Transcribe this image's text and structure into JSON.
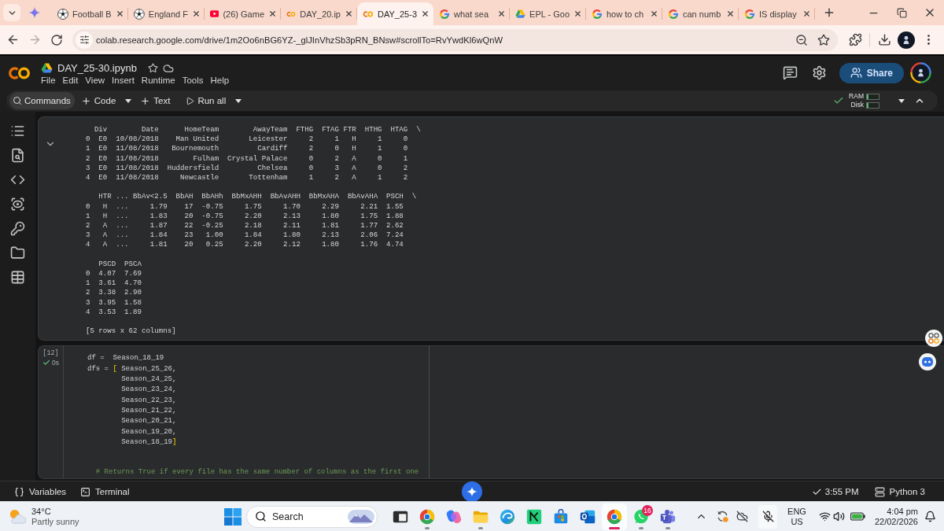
{
  "browser": {
    "tabs": [
      {
        "kind": "football",
        "title": "Football B",
        "selected": false
      },
      {
        "kind": "football",
        "title": "England F",
        "selected": false
      },
      {
        "kind": "youtube",
        "title": "(26) Game",
        "selected": false
      },
      {
        "kind": "colab",
        "title": "DAY_20.ip",
        "selected": false
      },
      {
        "kind": "colab",
        "title": "DAY_25-3",
        "selected": true
      },
      {
        "kind": "google",
        "title": "what sea",
        "selected": false
      },
      {
        "kind": "drive",
        "title": "EPL - Goo",
        "selected": false
      },
      {
        "kind": "google",
        "title": "how to ch",
        "selected": false
      },
      {
        "kind": "google",
        "title": "can numb",
        "selected": false
      },
      {
        "kind": "google",
        "title": "IS display",
        "selected": false
      }
    ],
    "forward_enabled": false,
    "url": "colab.research.google.com/drive/1m2Oo6nBG6YZ-_glJInVhzSb3pRN_BNsw#scrollTo=RvYwdKl6wQnW"
  },
  "notebook": {
    "title": "DAY_25-30.ipynb",
    "menu": [
      "File",
      "Edit",
      "View",
      "Insert",
      "Runtime",
      "Tools",
      "Help"
    ],
    "share": "Share"
  },
  "toolbar": {
    "commands": "Commands",
    "add_code": "Code",
    "add_text": "Text",
    "run_all": "Run all",
    "connected": true,
    "meters": [
      {
        "label": "RAM",
        "level": 0.1
      },
      {
        "label": "Disk",
        "level": 0.1
      }
    ]
  },
  "output": {
    "blocks": [
      {
        "lines": [
          "  Div        Date      HomeTeam        AwayTeam  FTHG  FTAG FTR  HTHG  HTAG  \\",
          "0  E0  10/08/2018    Man United       Leicester     2     1   H     1     0",
          "1  E0  11/08/2018   Bournemouth         Cardiff     2     0   H     1     0",
          "2  E0  11/08/2018        Fulham  Crystal Palace     0     2   A     0     1",
          "3  E0  11/08/2018  Huddersfield         Chelsea     0     3   A     0     2",
          "4  E0  11/08/2018     Newcastle       Tottenham     1     2   A     1     2"
        ]
      },
      {
        "lines": [
          "   HTR ... BbAv<2.5  BbAH  BbAHh  BbMxAHH  BbAvAHH  BbMxAHA  BbAvAHA  PSCH  \\",
          "0   H  ...     1.79    17  -0.75     1.75     1.70     2.29     2.21  1.55",
          "1   H  ...     1.83    20  -0.75     2.20     2.13     1.80     1.75  1.88",
          "2   A  ...     1.87    22  -0.25     2.18     2.11     1.81     1.77  2.62",
          "3   A  ...     1.84    23   1.00     1.84     1.80     2.13     2.06  7.24",
          "4   A  ...     1.81    20   0.25     2.20     2.12     1.80     1.76  4.74"
        ]
      },
      {
        "lines": [
          "   PSCD  PSCA",
          "0  4.07  7.69",
          "1  3.61  4.70",
          "2  3.38  2.90",
          "3  3.95  1.58",
          "4  3.53  1.89"
        ]
      },
      {
        "lines": [
          "[5 rows x 62 columns]"
        ]
      }
    ]
  },
  "code_cell": {
    "execution_count": "[12]",
    "succeeded": true,
    "duration": "0s",
    "lines": [
      [
        {
          "kind": "plain",
          "text": "df =  Season_18_19"
        }
      ],
      [
        {
          "kind": "plain",
          "text": "dfs = "
        },
        {
          "kind": "bracket",
          "text": "["
        },
        {
          "kind": "plain",
          "text": " Season_25_26,"
        }
      ],
      [
        {
          "kind": "plain",
          "text": "        Season_24_25,"
        }
      ],
      [
        {
          "kind": "plain",
          "text": "        Season_23_24,"
        }
      ],
      [
        {
          "kind": "plain",
          "text": "        Season_22_23,"
        }
      ],
      [
        {
          "kind": "plain",
          "text": "        Season_21_22,"
        }
      ],
      [
        {
          "kind": "plain",
          "text": "        Season_20_21,"
        }
      ],
      [
        {
          "kind": "plain",
          "text": "        Season_19_20,"
        }
      ],
      [
        {
          "kind": "plain",
          "text": "        Season_18_19"
        },
        {
          "kind": "bracket",
          "text": "]"
        }
      ],
      [
        {
          "kind": "comment",
          "text": "  # Returns True if every file has the same number of columns as the first one"
        }
      ]
    ]
  },
  "status_bar": {
    "variables": "Variables",
    "terminal": "Terminal",
    "saved_time": "3:55 PM",
    "runtime": "Python 3"
  },
  "taskbar": {
    "weather": {
      "temperature": "34°C",
      "condition": "Partly sunny"
    },
    "search_placeholder": "Search",
    "apps": [
      {
        "kind": "window",
        "running": false,
        "active": false
      },
      {
        "kind": "chrome",
        "running": true,
        "active": false
      },
      {
        "kind": "copilot",
        "running": false,
        "active": false
      },
      {
        "kind": "files",
        "running": true,
        "active": false
      },
      {
        "kind": "edge",
        "running": false,
        "active": false
      },
      {
        "kind": "tile",
        "running": false,
        "active": false
      },
      {
        "kind": "store",
        "running": false,
        "active": false
      },
      {
        "kind": "outlook",
        "running": false,
        "active": false
      },
      {
        "kind": "chrome",
        "running": true,
        "active": true
      },
      {
        "kind": "whatsapp",
        "running": true,
        "active": false,
        "badge": "16"
      },
      {
        "kind": "teams",
        "running": true,
        "active": false
      }
    ],
    "language": "ENG",
    "region": "US",
    "time": "4:04 pm",
    "date": "22/02/2026"
  }
}
